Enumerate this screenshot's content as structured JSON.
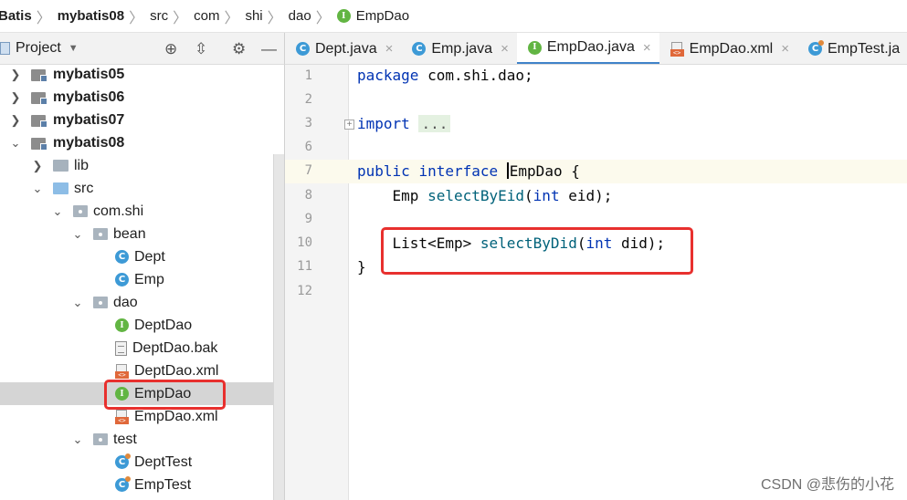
{
  "breadcrumb": {
    "items": [
      {
        "label": "Batis",
        "bold": true
      },
      {
        "label": "mybatis08",
        "bold": true
      },
      {
        "label": "src"
      },
      {
        "label": "com"
      },
      {
        "label": "shi"
      },
      {
        "label": "dao"
      },
      {
        "label": "EmpDao",
        "icon": "interface-icon"
      }
    ]
  },
  "project_panel": {
    "title": "Project",
    "tools": [
      "locate-icon",
      "collapse-icon",
      "gear-icon",
      "minimize-icon"
    ]
  },
  "tree": [
    {
      "label": "mybatis05",
      "type": "module",
      "depth": 0,
      "expanded": false,
      "bold": true
    },
    {
      "label": "mybatis06",
      "type": "module",
      "depth": 0,
      "expanded": false,
      "bold": true
    },
    {
      "label": "mybatis07",
      "type": "module",
      "depth": 0,
      "expanded": false,
      "bold": true
    },
    {
      "label": "mybatis08",
      "type": "module",
      "depth": 0,
      "expanded": true,
      "bold": true
    },
    {
      "label": "lib",
      "type": "folder",
      "depth": 1,
      "expanded": false
    },
    {
      "label": "src",
      "type": "source-folder",
      "depth": 1,
      "expanded": true
    },
    {
      "label": "com.shi",
      "type": "package",
      "depth": 2,
      "expanded": true
    },
    {
      "label": "bean",
      "type": "package",
      "depth": 3,
      "expanded": true
    },
    {
      "label": "Dept",
      "type": "class",
      "depth": 4
    },
    {
      "label": "Emp",
      "type": "class",
      "depth": 4
    },
    {
      "label": "dao",
      "type": "package",
      "depth": 3,
      "expanded": true
    },
    {
      "label": "DeptDao",
      "type": "interface",
      "depth": 4
    },
    {
      "label": "DeptDao.bak",
      "type": "file",
      "depth": 4
    },
    {
      "label": "DeptDao.xml",
      "type": "xml",
      "depth": 4
    },
    {
      "label": "EmpDao",
      "type": "interface",
      "depth": 4,
      "selected": true
    },
    {
      "label": "EmpDao.xml",
      "type": "xml",
      "depth": 4
    },
    {
      "label": "test",
      "type": "package",
      "depth": 3,
      "expanded": true
    },
    {
      "label": "DeptTest",
      "type": "test-class",
      "depth": 4
    },
    {
      "label": "EmpTest",
      "type": "test-class",
      "depth": 4
    }
  ],
  "tabs": [
    {
      "label": "Dept.java",
      "type": "class"
    },
    {
      "label": "Emp.java",
      "type": "class"
    },
    {
      "label": "EmpDao.java",
      "type": "interface",
      "active": true
    },
    {
      "label": "EmpDao.xml",
      "type": "xml"
    },
    {
      "label": "EmpTest.ja",
      "type": "test-class"
    }
  ],
  "editor": {
    "line_numbers": [
      "1",
      "2",
      "3",
      "6",
      "7",
      "8",
      "9",
      "10",
      "11",
      "12"
    ],
    "lines": {
      "l1_kw": "package",
      "l1_rest": " com.shi.dao;",
      "l3_kw": "import",
      "l3_fold": "...",
      "l7_kw1": "public",
      "l7_kw2": "interface",
      "l7_name": "EmpDao",
      "l7_rest": " {",
      "l8_type": "    Emp ",
      "l8_fn": "selectByEid",
      "l8_open": "(",
      "l8_kw": "int",
      "l8_rest": " eid);",
      "l10_type": "    List<Emp> ",
      "l10_fn": "selectByDid",
      "l10_open": "(",
      "l10_kw": "int",
      "l10_rest": " did);",
      "l11": "}"
    }
  },
  "watermark": "CSDN @悲伤的小花",
  "colors": {
    "highlight_box": "#e8302e",
    "tab_underline": "#4083c9",
    "keyword": "#0033b3",
    "method": "#00627a"
  }
}
